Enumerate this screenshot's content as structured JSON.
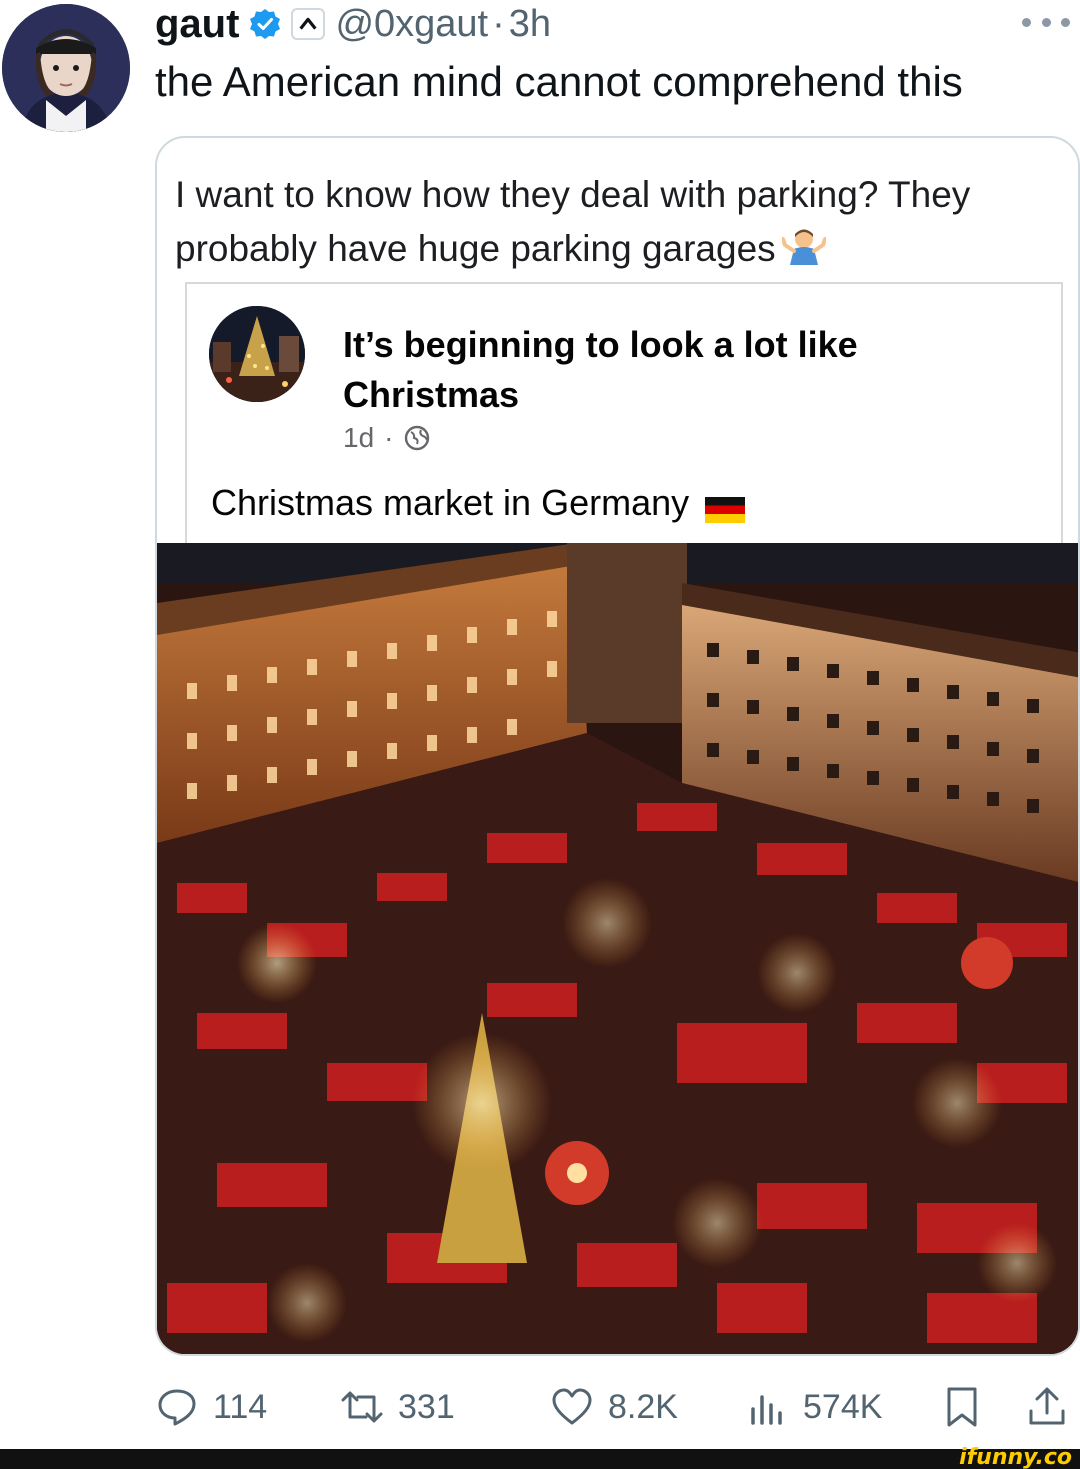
{
  "tweet": {
    "display_name": "gaut",
    "handle": "@0xgaut",
    "separator": "·",
    "time": "3h",
    "text": "the American mind cannot comprehend this"
  },
  "quote": {
    "text": "I want to know how they deal with parking? They probably have huge parking garages",
    "fb_post": {
      "title": "It’s beginning to look a lot like Christmas",
      "time": "1d",
      "separator": "·",
      "caption": "Christmas market in Germany"
    }
  },
  "actions": {
    "replies": "114",
    "retweets": "331",
    "likes": "8.2K",
    "views": "574K"
  },
  "watermark": "ifunny.co",
  "colors": {
    "verified": "#1d9bf0",
    "secondary_text": "#536471",
    "watermark": "#ffcc00"
  },
  "icons": [
    "verified-badge-icon",
    "affiliate-icon",
    "more-icon",
    "shrug-emoji-icon",
    "globe-icon",
    "german-flag-icon",
    "reply-icon",
    "retweet-icon",
    "like-icon",
    "views-icon",
    "bookmark-icon",
    "share-icon"
  ]
}
